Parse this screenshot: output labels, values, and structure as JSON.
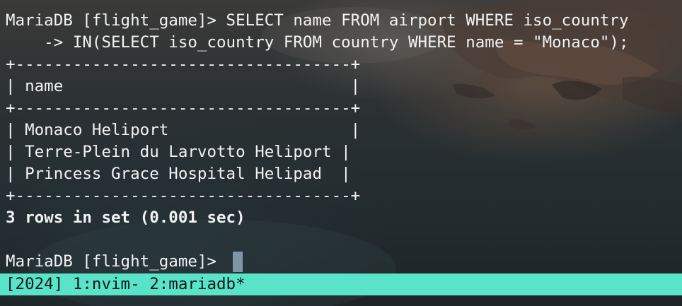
{
  "terminal": {
    "lines": [
      "MariaDB [flight_game]> SELECT name FROM airport WHERE iso_country",
      "    -> IN(SELECT iso_country FROM country WHERE name = \"Monaco\");",
      "+-----------------------------------+",
      "| name                              |",
      "+-----------------------------------+",
      "| Monaco Heliport                   |",
      "| Terre-Plein du Larvotto Heliport |",
      "| Princess Grace Hospital Helipad  |",
      "+-----------------------------------+",
      "3 rows in set (0.001 sec)",
      "",
      "MariaDB [flight_game]> "
    ]
  },
  "tmux": {
    "status": "[2024] 1:nvim- 2:mariadb*"
  },
  "colors": {
    "text": "#f2f2f2",
    "cursor": "#7f96a8",
    "tmux_bar": "#59e3c8"
  }
}
